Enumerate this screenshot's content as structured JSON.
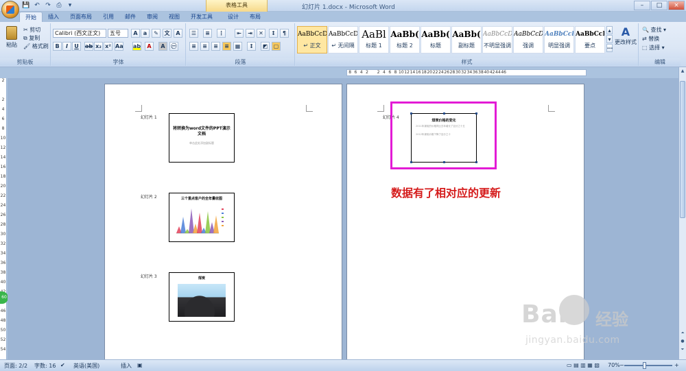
{
  "window": {
    "title": "幻灯片 1.docx - Microsoft Word",
    "context_tab": "表格工具",
    "controls": [
      "–",
      "□",
      "×"
    ]
  },
  "tabs": [
    "开始",
    "插入",
    "页面布局",
    "引用",
    "邮件",
    "审阅",
    "视图",
    "开发工具",
    "设计",
    "布局"
  ],
  "clipboard": {
    "paste": "粘贴",
    "cut": "剪切",
    "copy": "复制",
    "format_painter": "格式刷",
    "label": "剪贴板"
  },
  "font": {
    "family": "Calibri (西文正文)",
    "size": "五号",
    "label": "字体"
  },
  "paragraph": {
    "label": "段落"
  },
  "styles": {
    "label": "样式",
    "items": [
      {
        "sample": "AaBbCcDc",
        "name": "↵ 正文"
      },
      {
        "sample": "AaBbCcDc",
        "name": "↵ 无间隔"
      },
      {
        "sample": "AaBl",
        "name": "标题 1"
      },
      {
        "sample": "AaBb(",
        "name": "标题 2"
      },
      {
        "sample": "AaBb(",
        "name": "标题"
      },
      {
        "sample": "AaBb(",
        "name": "副标题"
      },
      {
        "sample": "AaBbCcDc",
        "name": "不明显强调"
      },
      {
        "sample": "AaBbCcDc",
        "name": "强调"
      },
      {
        "sample": "AaBbCcl",
        "name": "明显强调"
      },
      {
        "sample": "AaBbCcL",
        "name": "要点"
      }
    ],
    "change": "更改样式"
  },
  "editing": {
    "find": "查找",
    "replace": "替换",
    "select": "选择",
    "label": "编辑"
  },
  "ruler_ticks": [
    "8",
    "6",
    "4",
    "2",
    "",
    "2",
    "4",
    "6",
    "8",
    "10",
    "12",
    "14",
    "16",
    "18",
    "20",
    "22",
    "24",
    "26",
    "28",
    "30",
    "32",
    "34",
    "36",
    "38",
    "40",
    "42",
    "44",
    "46"
  ],
  "ruler_left": [
    "2",
    "",
    "2",
    "4",
    "6",
    "8",
    "10",
    "12",
    "14",
    "16",
    "18",
    "20",
    "22",
    "24",
    "26",
    "28",
    "30",
    "32",
    "34",
    "36",
    "38",
    "40",
    "42",
    "44",
    "46",
    "48",
    "50",
    "52",
    "54"
  ],
  "page1": {
    "slides": [
      {
        "label": "幻灯片 1",
        "title": "将转换为word文件的PPT演示文档",
        "sub": "单击此处添加副标题"
      },
      {
        "label": "幻灯片 2",
        "title": "三个重点客户的全年量收图"
      },
      {
        "label": "幻灯片 3",
        "title": "煤炭"
      }
    ]
  },
  "page2": {
    "slide": {
      "label": "幻灯片 4",
      "title": "煤炭价格的变化",
      "bullets": [
        "2011年煤炭的价格同比去年增长了百分之十五",
        "2012年煤炭价格下降了百分之十"
      ]
    },
    "annotation": "数据有了相对应的更新"
  },
  "status": {
    "page": "页面: 2/2",
    "words": "字数: 16",
    "language": "英语(美国)",
    "mode": "插入",
    "zoom": "70%"
  },
  "watermark": {
    "brand": "Bai",
    "jingyan": "经验",
    "url": "jingyan.baidu.com"
  },
  "chart_thumb": {
    "type": "area",
    "colors": [
      "#e2425a",
      "#4b7fd8",
      "#8ac53e",
      "#8c5bb8",
      "#f2a33a"
    ]
  },
  "colors": {
    "highlight": "#e31bd5",
    "annotation": "#d51b1b"
  }
}
